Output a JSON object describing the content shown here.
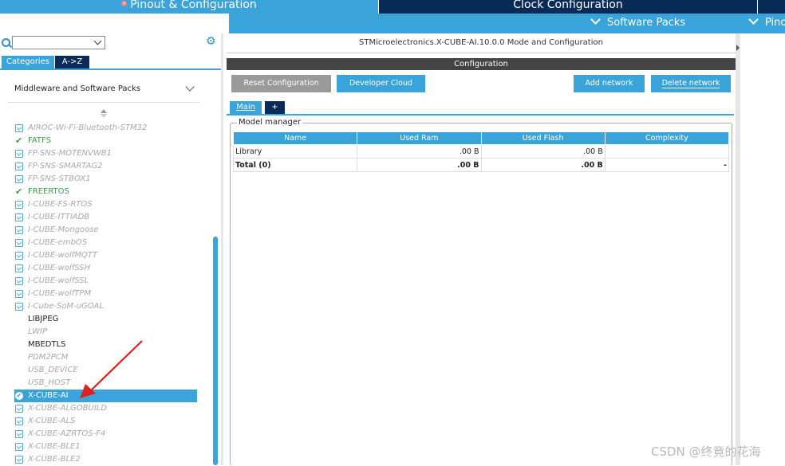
{
  "tabs": {
    "pinout": "Pinout & Configuration",
    "clock": "Clock Configuration",
    "right": "",
    "software_packs": "Software Packs",
    "pinout_short": "Pino"
  },
  "left": {
    "search_value": "",
    "tab_categories": "Categories",
    "tab_az": "A->Z",
    "section_title": "Middleware and Software Packs",
    "packs": [
      {
        "label": "AIROC-Wi-Fi-Bluetooth-STM32",
        "state": "disabled",
        "icon": "download-icon"
      },
      {
        "label": "FATFS",
        "state": "enabled",
        "icon": "check-icon"
      },
      {
        "label": "FP-SNS-MOTENVWB1",
        "state": "disabled",
        "icon": "download-icon"
      },
      {
        "label": "FP-SNS-SMARTAG2",
        "state": "disabled",
        "icon": "download-icon"
      },
      {
        "label": "FP-SNS-STBOX1",
        "state": "disabled",
        "icon": "download-icon"
      },
      {
        "label": "FREERTOS",
        "state": "enabled",
        "icon": "check-icon"
      },
      {
        "label": "I-CUBE-FS-RTOS",
        "state": "disabled",
        "icon": "download-icon"
      },
      {
        "label": "I-CUBE-ITTIADB",
        "state": "disabled",
        "icon": "download-icon"
      },
      {
        "label": "I-CUBE-Mongoose",
        "state": "disabled",
        "icon": "download-icon"
      },
      {
        "label": "I-CUBE-embOS",
        "state": "disabled",
        "icon": "download-icon"
      },
      {
        "label": "I-CUBE-wolfMQTT",
        "state": "disabled",
        "icon": "download-icon"
      },
      {
        "label": "I-CUBE-wolfSSH",
        "state": "disabled",
        "icon": "download-icon"
      },
      {
        "label": "I-CUBE-wolfSSL",
        "state": "disabled",
        "icon": "download-icon"
      },
      {
        "label": "I-CUBE-wolfTPM",
        "state": "disabled",
        "icon": "download-icon"
      },
      {
        "label": "I-Cube-SoM-uGOAL",
        "state": "disabled",
        "icon": "download-icon"
      },
      {
        "label": "LIBJPEG",
        "state": "plain",
        "icon": ""
      },
      {
        "label": "LWIP",
        "state": "disabled",
        "icon": ""
      },
      {
        "label": "MBEDTLS",
        "state": "plain",
        "icon": ""
      },
      {
        "label": "PDM2PCM",
        "state": "disabled",
        "icon": ""
      },
      {
        "label": "USB_DEVICE",
        "state": "disabled",
        "icon": ""
      },
      {
        "label": "USB_HOST",
        "state": "disabled",
        "icon": ""
      },
      {
        "label": "X-CUBE-AI",
        "state": "selected",
        "icon": "check-circle-icon"
      },
      {
        "label": "X-CUBE-ALGOBUILD",
        "state": "disabled",
        "icon": "download-icon"
      },
      {
        "label": "X-CUBE-ALS",
        "state": "disabled",
        "icon": "download-icon"
      },
      {
        "label": "X-CUBE-AZRTOS-F4",
        "state": "disabled",
        "icon": "download-icon"
      },
      {
        "label": "X-CUBE-BLE1",
        "state": "disabled",
        "icon": "download-icon"
      },
      {
        "label": "X-CUBE-BLE2",
        "state": "disabled",
        "icon": "download-icon"
      }
    ]
  },
  "main": {
    "title": "STMicroelectronics.X-CUBE-AI.10.0.0 Mode and Configuration",
    "config_label": "Configuration",
    "buttons": {
      "reset": "Reset Configuration",
      "developer_cloud": "Developer Cloud",
      "add_network": "Add network",
      "delete_network": "Delete network"
    },
    "tabs": {
      "main": "Main",
      "plus": "+"
    },
    "model_manager": {
      "legend": "Model manager",
      "columns": [
        "Name",
        "Used Ram",
        "Used Flash",
        "Complexity"
      ],
      "rows": [
        [
          "Library",
          ".00 B",
          ".00 B",
          ""
        ],
        [
          "Total (0)",
          ".00 B",
          ".00 B",
          "-"
        ]
      ]
    }
  },
  "watermark": "CSDN @终竟的花海",
  "colors": {
    "accent": "#3aa3d9",
    "navy": "#0a2a57",
    "enabled": "#3aa14a",
    "arrow": "#e02020"
  }
}
